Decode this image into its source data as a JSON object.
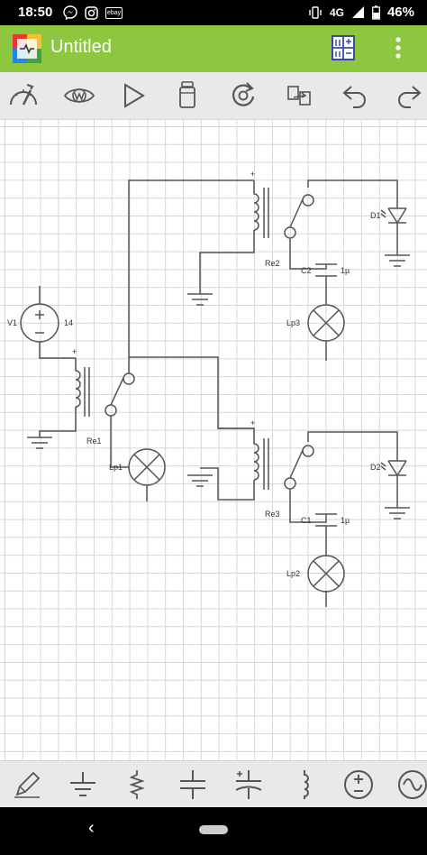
{
  "status_bar": {
    "time": "18:50",
    "notification_badge": "ebay",
    "network": "4G",
    "battery": "46%"
  },
  "app_bar": {
    "title": "Untitled",
    "background_color": "#8dc63f"
  },
  "toolbar": {
    "icons": [
      "wrench-gauge-icon",
      "eye-w-icon",
      "play-icon",
      "trash-icon",
      "rotate-icon",
      "flip-icon",
      "undo-icon",
      "redo-icon"
    ]
  },
  "schematic": {
    "components": {
      "V1": {
        "label": "V1",
        "value": "14"
      },
      "Re1": {
        "label": "Re1"
      },
      "Re2": {
        "label": "Re2"
      },
      "Re3": {
        "label": "Re3"
      },
      "Lp1": {
        "label": "Lp1"
      },
      "Lp2": {
        "label": "Lp2"
      },
      "Lp3": {
        "label": "Lp3"
      },
      "C1": {
        "label": "C1",
        "value": "1µ"
      },
      "C2": {
        "label": "C2",
        "value": "1µ"
      },
      "D1": {
        "label": "D1"
      },
      "D2": {
        "label": "D2"
      }
    },
    "plus_sign": "+"
  },
  "bottom_bar": {
    "icons": [
      "pencil-icon",
      "ground-icon",
      "resistor-icon",
      "capacitor-icon",
      "polarized-capacitor-icon",
      "inductor-icon",
      "dc-source-icon",
      "ac-source-icon"
    ]
  },
  "nav_bar": {
    "back_glyph": "‹"
  }
}
